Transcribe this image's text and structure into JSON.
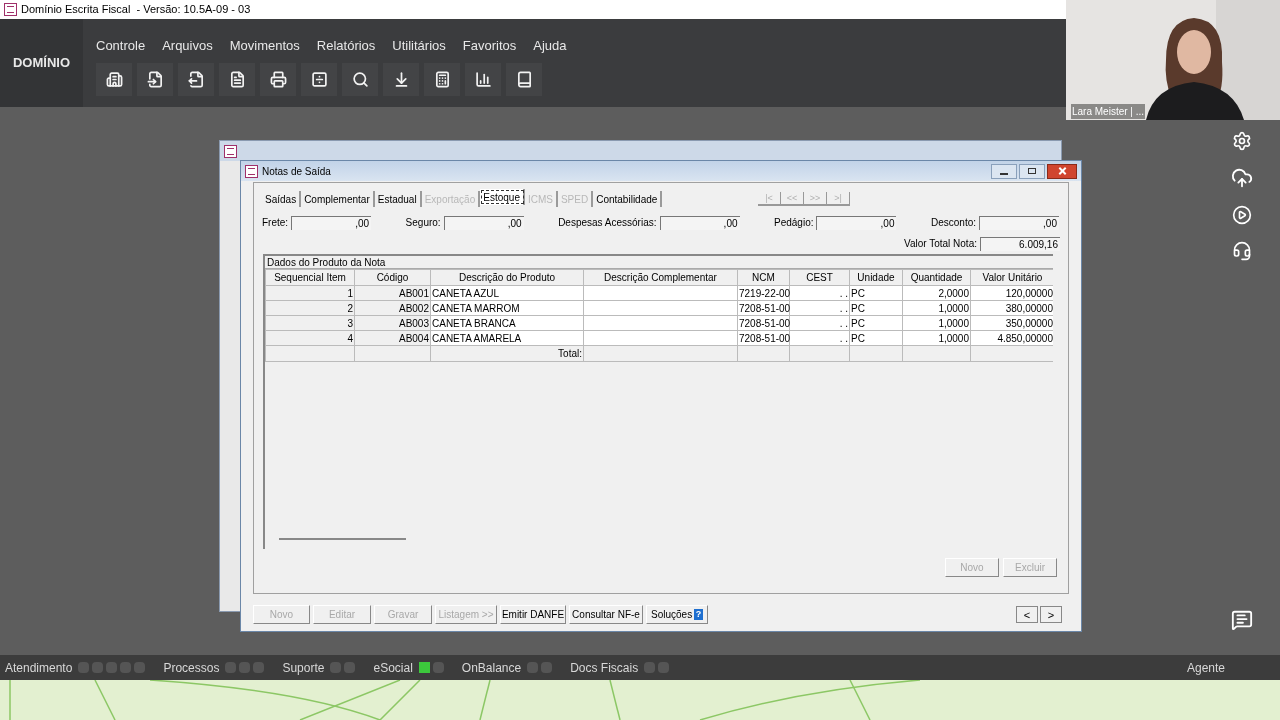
{
  "window": {
    "title": "Domínio Escrita Fiscal  - Versão: 10.5A-09 - 03"
  },
  "logo": "DOMÍNIO",
  "menu": [
    "Controle",
    "Arquivos",
    "Movimentos",
    "Relatórios",
    "Utilitários",
    "Favoritos",
    "Ajuda"
  ],
  "dialog": {
    "title": "Notas de Saída",
    "tabs": [
      {
        "label": "Saídas",
        "selected": false,
        "disabled": false
      },
      {
        "label": "Complementar",
        "selected": false,
        "disabled": false
      },
      {
        "label": "Estadual",
        "selected": false,
        "disabled": false
      },
      {
        "label": "Exportação",
        "selected": false,
        "disabled": true
      },
      {
        "label": "Estoque",
        "selected": true,
        "disabled": false
      },
      {
        "label": "ICMS",
        "selected": false,
        "disabled": true
      },
      {
        "label": "SPED",
        "selected": false,
        "disabled": true
      },
      {
        "label": "Contabilidade",
        "selected": false,
        "disabled": false
      }
    ],
    "nav_buttons": [
      {
        "label": "|<",
        "disabled": true
      },
      {
        "label": "<<",
        "disabled": true
      },
      {
        "label": ">>",
        "disabled": true
      },
      {
        "label": ">|",
        "disabled": true
      }
    ],
    "fields": [
      {
        "label": "Frete:",
        "value": ",00"
      },
      {
        "label": "Seguro:",
        "value": ",00"
      },
      {
        "label": "Despesas Acessórias:",
        "value": ",00"
      },
      {
        "label": "Pedágio:",
        "value": ",00"
      },
      {
        "label": "Desconto:",
        "value": ",00"
      }
    ],
    "total": {
      "label": "Valor Total Nota:",
      "value": "6.009,16"
    },
    "table": {
      "caption": "Dados do Produto da Nota",
      "columns": [
        "Sequencial Item",
        "Código",
        "Descrição do Produto",
        "Descrição Complementar",
        "NCM",
        "CEST",
        "Unidade",
        "Quantidade",
        "Valor Unitário"
      ],
      "rows": [
        [
          "1",
          "AB001",
          "CANETA AZUL",
          "",
          "7219-22-00",
          ". .",
          "PC",
          "2,0000",
          "120,00000"
        ],
        [
          "2",
          "AB002",
          "CANETA MARROM",
          "",
          "7208-51-00",
          ". .",
          "PC",
          "1,0000",
          "380,00000"
        ],
        [
          "3",
          "AB003",
          "CANETA BRANCA",
          "",
          "7208-51-00",
          ". .",
          "PC",
          "1,0000",
          "350,00000"
        ],
        [
          "4",
          "AB004",
          "CANETA AMARELA",
          "",
          "7208-51-00",
          ". .",
          "PC",
          "1,0000",
          "4.850,00000"
        ]
      ],
      "total_label": "Total:"
    },
    "grid_buttons": [
      {
        "label": "Novo",
        "disabled": true
      },
      {
        "label": "Excluir",
        "disabled": true
      }
    ],
    "footer_buttons": [
      {
        "label": "Novo",
        "disabled": true
      },
      {
        "label": "Editar",
        "disabled": true
      },
      {
        "label": "Gravar",
        "disabled": true
      },
      {
        "label": "Listagem >>",
        "disabled": true
      },
      {
        "label": "Emitir DANFE",
        "disabled": false
      },
      {
        "label": "Consultar NF-e",
        "disabled": false
      },
      {
        "label": "Soluções",
        "disabled": false,
        "help": "?"
      }
    ],
    "pager": [
      "<",
      ">"
    ]
  },
  "video": {
    "name": "Lara Meister | ..."
  },
  "status_bar": [
    {
      "label": "Atendimento"
    },
    {
      "label": "Processos"
    },
    {
      "label": "Suporte"
    },
    {
      "label": "eSocial"
    },
    {
      "label": "OnBalance"
    },
    {
      "label": "Docs Fiscais"
    }
  ],
  "agent": "Agente"
}
